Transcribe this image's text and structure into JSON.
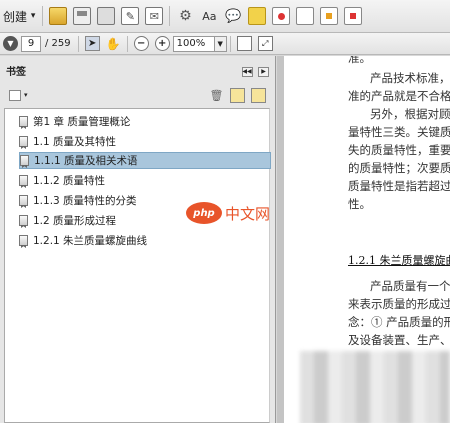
{
  "toolbar": {
    "create_label": "创建",
    "create_arrow": "▾"
  },
  "navbar": {
    "page_current": "9",
    "page_total": "/ 259",
    "zoom_value": "100%"
  },
  "panel": {
    "title": "书签",
    "collapse_label": "◀◀",
    "options_label": "▶"
  },
  "bookmarks": [
    {
      "label": "第1 章 质量管理概论"
    },
    {
      "label": "1.1 质量及其特性"
    },
    {
      "label": "1.1.1 质量及相关术语"
    },
    {
      "label": "1.1.2 质量特性"
    },
    {
      "label": "1.1.3 质量特性的分类"
    },
    {
      "label": "1.2 质量形成过程"
    },
    {
      "label": "1.2.1 朱兰质量螺旋曲线"
    }
  ],
  "selected_bookmark": 2,
  "document": {
    "lines": [
      "准。",
      "产品技术标准，",
      "准的产品就是不合格",
      "另外，根据对顾",
      "量特性三类。关键质",
      "失的质量特性，重要",
      "的质量特性；次要质",
      "质量特性是指若超过",
      "性。"
    ],
    "section_heading": "1.2.1   朱兰质量螺旋曲",
    "lines2": [
      "产品质量有一个",
      "来表示质量的形成过",
      "念：① 产品质量的形",
      "及设备装置、生产、"
    ]
  },
  "watermark": {
    "logo": "php",
    "text": "中文网"
  },
  "colors": {
    "selection": "#a9c6dc",
    "watermark": "#e8542a"
  }
}
